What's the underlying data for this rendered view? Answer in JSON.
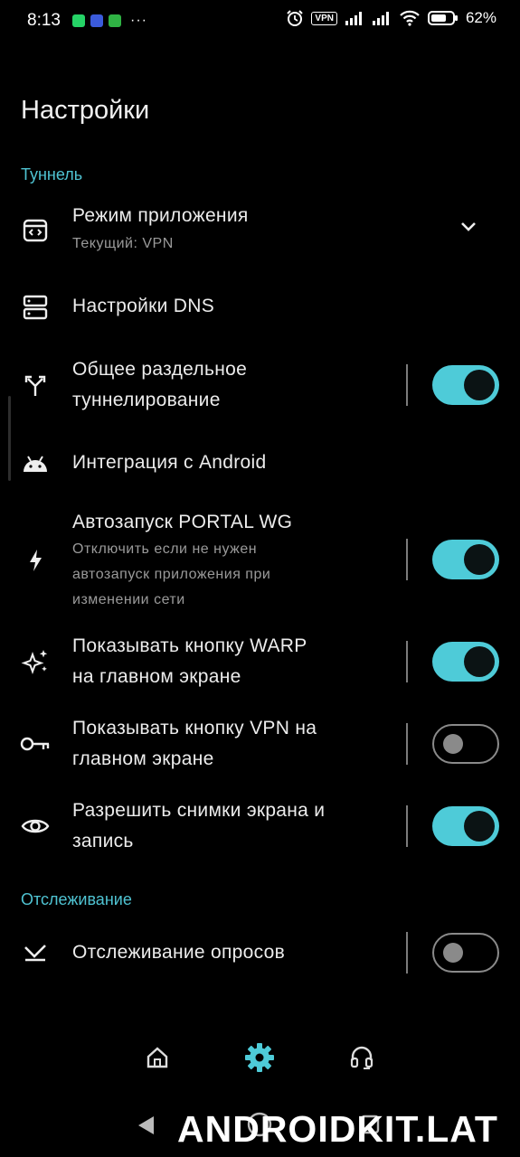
{
  "status_bar": {
    "time": "8:13",
    "dots": "···",
    "vpn_badge": "VPN",
    "battery_percent": "62%"
  },
  "page": {
    "title": "Настройки"
  },
  "sections": {
    "tunnel": "Туннель",
    "tracking": "Отслеживание"
  },
  "settings": {
    "app_mode": {
      "title": "Режим приложения",
      "subtitle": "Текущий: VPN"
    },
    "dns": {
      "title": "Настройки DNS"
    },
    "split_tunnel": {
      "title_line1": "Общее раздельное",
      "title_line2": "туннелирование",
      "enabled": true
    },
    "android": {
      "title": "Интеграция с Android"
    },
    "autostart": {
      "title": "Автозапуск PORTAL WG",
      "sub_line1": "Отключить если не нужен",
      "sub_line2": "автозапуск приложения при",
      "sub_line3": "изменении сети",
      "enabled": true
    },
    "warp_button": {
      "title_line1": "Показывать кнопку WARP",
      "title_line2": "на главном экране",
      "enabled": true
    },
    "vpn_button": {
      "title_line1": "Показывать кнопку VPN на",
      "title_line2": "главном экране",
      "enabled": false
    },
    "screenshots": {
      "title_line1": "Разрешить снимки экрана и",
      "title_line2": "запись",
      "enabled": true
    },
    "polls": {
      "title": "Отслеживание опросов",
      "enabled": false
    }
  },
  "icons": {
    "app_mode": "app-window-icon",
    "dns": "dns-server-icon",
    "split": "split-arrow-icon",
    "android": "android-icon",
    "autostart": "bolt-icon",
    "warp": "sparkles-icon",
    "vpn": "key-icon",
    "screenshots": "eye-icon",
    "polls": "poll-tracking-icon",
    "nav_home": "home-icon",
    "nav_settings": "gear-icon",
    "nav_support": "headset-icon"
  },
  "colors": {
    "accent": "#4ecbd8",
    "background": "#000000",
    "section": "#4fc3d2"
  },
  "watermark": "ANDROIDKIT.LAT"
}
